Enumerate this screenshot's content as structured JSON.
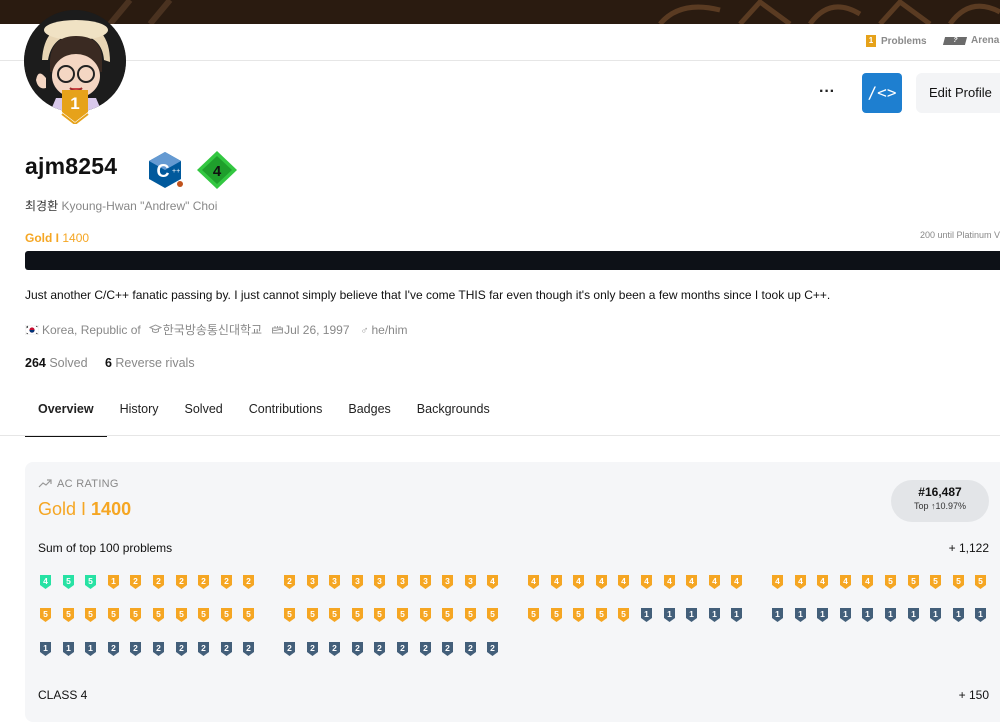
{
  "nav": {
    "problems": "Problems",
    "problems_icon_text": "1",
    "arena": "Arena",
    "arena_icon_text": "?"
  },
  "avatar": {
    "tier_badge": "1"
  },
  "actions": {
    "more": "···",
    "code_icon": "/<>",
    "edit_profile": "Edit Profile"
  },
  "profile": {
    "username": "ajm8254",
    "class_badge": "4",
    "name_ko": "최경환",
    "name_en": "Kyoung-Hwan \"Andrew\" Choi",
    "tier_name": "Gold I",
    "tier_rating": "1400",
    "until_text": "200 until Platinum V",
    "bio": "Just another C/C++ fanatic passing by. I just cannot simply believe that I've come THIS far even though it's only been a few months since I took up C++.",
    "country": "Korea, Republic of",
    "school": "한국방송통신대학교",
    "birthday": "Jul 26, 1997",
    "pronouns": "he/him",
    "solved_count": "264",
    "solved_label": "Solved",
    "rivals_count": "6",
    "rivals_label": "Reverse rivals"
  },
  "tabs": [
    "Overview",
    "History",
    "Solved",
    "Contributions",
    "Badges",
    "Backgrounds"
  ],
  "rating": {
    "label": "AC RATING",
    "tier": "Gold I",
    "value": "1400",
    "rank": "#16,487",
    "top": "Top ↑10.97%",
    "sum_label": "Sum of top 100 problems",
    "sum_value": "+ 1,122",
    "class_label": "CLASS 4",
    "class_value": "+ 150"
  },
  "tier_icons": {
    "row1": [
      "P4",
      "P5",
      "P5",
      "G1",
      "G2",
      "G2",
      "G2",
      "G2",
      "G2",
      "G2",
      "G2",
      "G3",
      "G3",
      "G3",
      "G3",
      "G3",
      "G3",
      "G3",
      "G3",
      "G4",
      "G4",
      "G4",
      "G4",
      "G4",
      "G4",
      "G4",
      "G4",
      "G4",
      "G4",
      "G4",
      "G4",
      "G4",
      "G4",
      "G4",
      "G4",
      "G5",
      "G5",
      "G5",
      "G5",
      "G5"
    ],
    "row2": [
      "G5",
      "G5",
      "G5",
      "G5",
      "G5",
      "G5",
      "G5",
      "G5",
      "G5",
      "G5",
      "G5",
      "G5",
      "G5",
      "G5",
      "G5",
      "G5",
      "G5",
      "G5",
      "G5",
      "G5",
      "G5",
      "G5",
      "G5",
      "G5",
      "G5",
      "S1",
      "S1",
      "S1",
      "S1",
      "S1",
      "S1",
      "S1",
      "S1",
      "S1",
      "S1",
      "S1",
      "S1",
      "S1",
      "S1",
      "S1"
    ],
    "row3": [
      "S1",
      "S1",
      "S1",
      "S2",
      "S2",
      "S2",
      "S2",
      "S2",
      "S2",
      "S2",
      "S2",
      "S2",
      "S2",
      "S2",
      "S2",
      "S2",
      "S2",
      "S2",
      "S2",
      "S2"
    ]
  },
  "colors": {
    "gold": "#f5a623",
    "platinum": "#27e2a4",
    "silver": "#435f7a",
    "ruby": "#e0004e"
  }
}
